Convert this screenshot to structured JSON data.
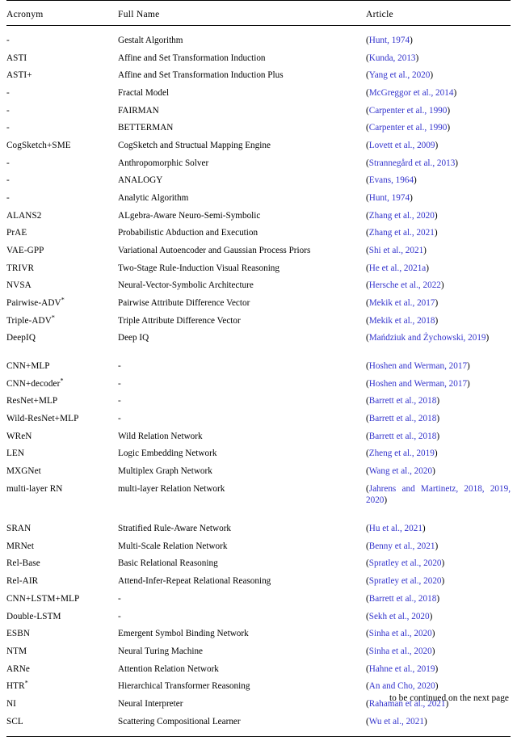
{
  "table": {
    "columns": [
      "Acronym",
      "Full Name",
      "Article"
    ],
    "rows": [
      {
        "acronym": "-",
        "full_name": "Gestalt Algorithm",
        "citation": "Hunt, 1974"
      },
      {
        "acronym": "ASTI",
        "full_name": "Affine and Set Transformation Induction",
        "citation": "Kunda, 2013"
      },
      {
        "acronym": "ASTI+",
        "full_name": "Affine and Set Transformation Induction Plus",
        "citation": "Yang et al., 2020"
      },
      {
        "acronym": "-",
        "full_name": "Fractal Model",
        "citation": "McGreggor et al., 2014"
      },
      {
        "acronym": "-",
        "full_name": "FAIRMAN",
        "citation": "Carpenter et al., 1990"
      },
      {
        "acronym": "-",
        "full_name": "BETTERMAN",
        "citation": "Carpenter et al., 1990"
      },
      {
        "acronym": "CogSketch+SME",
        "full_name": "CogSketch and Structual Mapping Engine",
        "citation": "Lovett et al., 2009"
      },
      {
        "acronym": "-",
        "full_name": "Anthropomorphic Solver",
        "citation": "Strannegård et al., 2013"
      },
      {
        "acronym": "-",
        "full_name": "ANALOGY",
        "citation": "Evans, 1964"
      },
      {
        "acronym": "-",
        "full_name": "Analytic Algorithm",
        "citation": "Hunt, 1974"
      },
      {
        "acronym": "ALANS2",
        "full_name": "ALgebra-Aware Neuro-Semi-Symbolic",
        "citation": "Zhang et al., 2020"
      },
      {
        "acronym": "PrAE",
        "full_name": "Probabilistic Abduction and Execution",
        "citation": "Zhang et al., 2021"
      },
      {
        "acronym": "VAE-GPP",
        "full_name": "Variational Autoencoder and Gaussian Process Priors",
        "citation": "Shi et al., 2021",
        "wrap_full": true
      },
      {
        "acronym": "TRIVR",
        "full_name": "Two-Stage Rule-Induction Visual Reasoning",
        "citation": "He et al., 2021a"
      },
      {
        "acronym": "NVSA",
        "full_name": "Neural-Vector-Symbolic Architecture",
        "citation": "Hersche et al., 2022"
      },
      {
        "acronym": "Pairwise-ADV",
        "acronym_star": true,
        "full_name": "Pairwise Attribute Difference Vector",
        "citation": "Mekik et al., 2017"
      },
      {
        "acronym": "Triple-ADV",
        "acronym_star": true,
        "full_name": "Triple Attribute Difference Vector",
        "citation": "Mekik et al., 2018"
      },
      {
        "acronym": "DeepIQ",
        "full_name": "Deep IQ",
        "citation": "Mańdziuk and Żychowski, 2019",
        "wrap_cite": true
      },
      {
        "spacer": true
      },
      {
        "acronym": "CNN+MLP",
        "full_name": "-",
        "citation": "Hoshen and Werman, 2017"
      },
      {
        "acronym": "CNN+decoder",
        "acronym_star": true,
        "full_name": "-",
        "citation": "Hoshen and Werman, 2017"
      },
      {
        "acronym": "ResNet+MLP",
        "full_name": "-",
        "citation": "Barrett et al., 2018"
      },
      {
        "acronym": "Wild-ResNet+MLP",
        "full_name": "-",
        "citation": "Barrett et al., 2018"
      },
      {
        "acronym": "WReN",
        "full_name": "Wild Relation Network",
        "citation": "Barrett et al., 2018"
      },
      {
        "acronym": "LEN",
        "full_name": "Logic Embedding Network",
        "citation": "Zheng et al., 2019"
      },
      {
        "acronym": "MXGNet",
        "full_name": "Multiplex Graph Network",
        "citation": "Wang et al., 2020"
      },
      {
        "acronym": "multi-layer RN",
        "full_name": "multi-layer Relation Network",
        "citation": "Jahrens and Martinetz, 2018, 2019, 2020",
        "wrap_cite": true
      },
      {
        "spacer": true
      },
      {
        "acronym": "SRAN",
        "full_name": "Stratified Rule-Aware Network",
        "citation": "Hu et al., 2021"
      },
      {
        "acronym": "MRNet",
        "full_name": "Multi-Scale Relation Network",
        "citation": "Benny et al., 2021"
      },
      {
        "acronym": "Rel-Base",
        "full_name": "Basic Relational Reasoning",
        "citation": "Spratley et al., 2020"
      },
      {
        "acronym": "Rel-AIR",
        "full_name": "Attend-Infer-Repeat Relational Reasoning",
        "citation": "Spratley et al., 2020"
      },
      {
        "acronym": "CNN+LSTM+MLP",
        "full_name": "-",
        "citation": "Barrett et al., 2018"
      },
      {
        "acronym": "Double-LSTM",
        "full_name": "-",
        "citation": "Sekh et al., 2020"
      },
      {
        "acronym": "ESBN",
        "full_name": "Emergent Symbol Binding Network",
        "citation": "Sinha et al., 2020"
      },
      {
        "acronym": "NTM",
        "full_name": "Neural Turing Machine",
        "citation": "Sinha et al., 2020"
      },
      {
        "acronym": "ARNe",
        "full_name": "Attention Relation Network",
        "citation": "Hahne et al., 2019"
      },
      {
        "acronym": "HTR",
        "acronym_star": true,
        "full_name": "Hierarchical Transformer Reasoning",
        "citation": "An and Cho, 2020"
      },
      {
        "acronym": "NI",
        "full_name": "Neural Interpreter",
        "citation": "Rahaman et al., 2021"
      },
      {
        "acronym": "SCL",
        "full_name": "Scattering Compositional Learner",
        "citation": "Wu et al., 2021"
      }
    ]
  },
  "footer": {
    "text": "to be continued on the next page"
  },
  "colors": {
    "citation_link": "#3333cc",
    "text": "#000000",
    "rule": "#000000"
  }
}
